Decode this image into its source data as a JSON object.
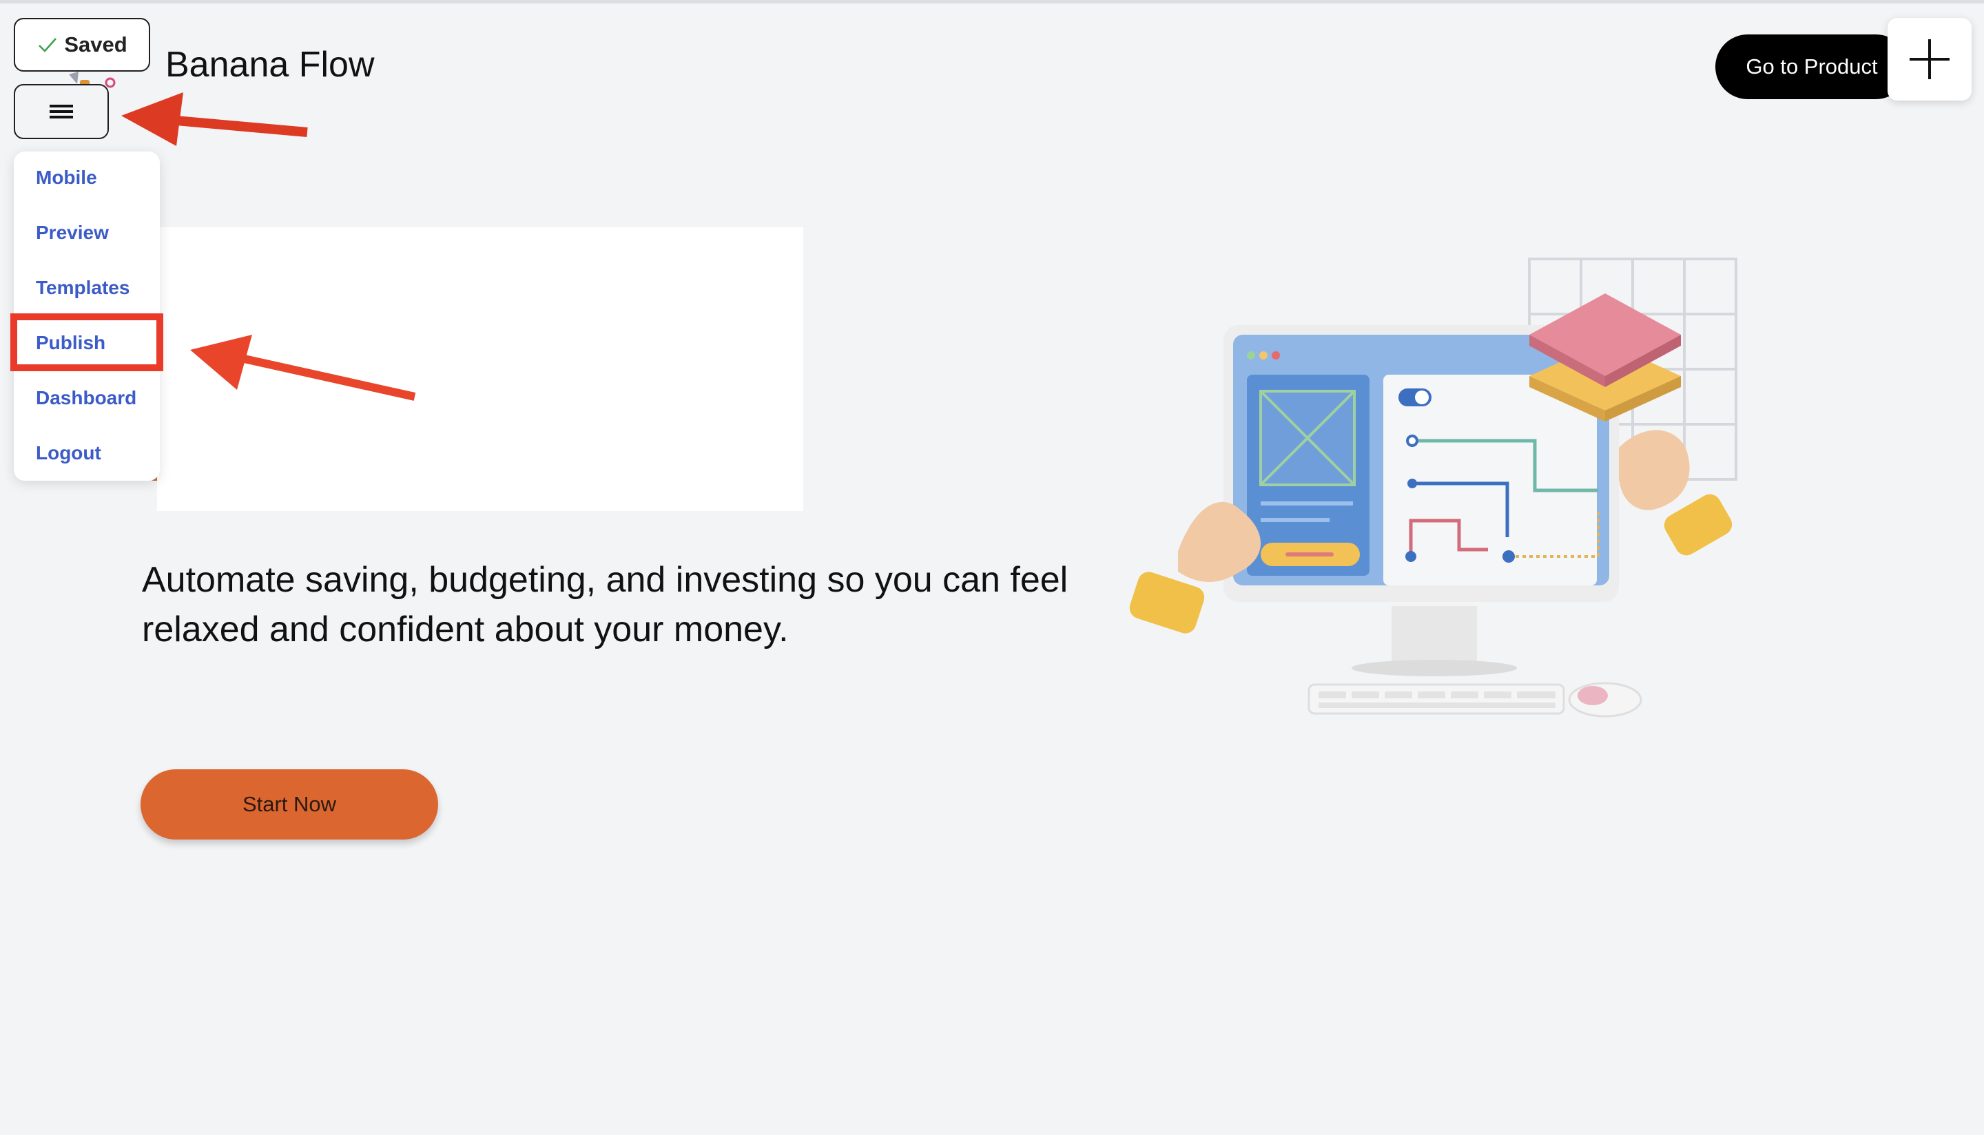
{
  "app": {
    "brand": "Banana Flow",
    "saved_label": "Saved"
  },
  "menu": {
    "items": [
      {
        "label": "Mobile"
      },
      {
        "label": "Preview"
      },
      {
        "label": "Templates"
      },
      {
        "label": "Publish"
      },
      {
        "label": "Dashboard"
      },
      {
        "label": "Logout"
      }
    ],
    "highlighted_item": "Publish"
  },
  "hero": {
    "headline": "Automate saving, budgeting, and investing so you can feel relaxed and confident about your money.",
    "cta_label": "Start Now"
  },
  "header": {
    "go_to_product_label": "Go to Product"
  },
  "icons": {
    "saved": "check-icon",
    "menu": "hamburger-icon",
    "add": "plus-icon"
  },
  "colors": {
    "cta": "#dc662f",
    "menu_link": "#3b5bc7",
    "annotation": "#ea3a2a",
    "background": "#f3f4f6"
  }
}
